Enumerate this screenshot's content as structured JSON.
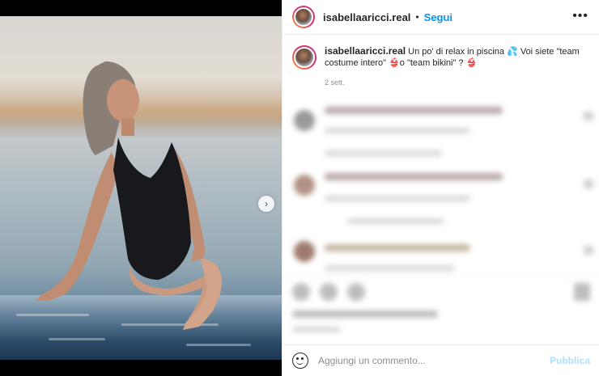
{
  "post": {
    "username": "isabellaaricci.real",
    "follow_label": "Segui",
    "more_label": "•••",
    "separator": "•",
    "caption_text": "Un po' di relax in piscina 💦 Voi siete \"team costume intero\" 👙o \"team bikini\" ? 👙",
    "timestamp": "2 sett.",
    "next_arrow": "›"
  },
  "composer": {
    "placeholder": "Aggiungi un commento...",
    "publish_label": "Pubblica"
  },
  "colors": {
    "follow": "#0095f6",
    "publish_disabled": "#b2dffc",
    "muted_text": "#8e8e8e"
  },
  "icons": [
    "more-options-icon",
    "next-arrow-icon",
    "emoji-icon",
    "heart-icon",
    "comment-icon",
    "share-icon",
    "save-icon"
  ]
}
